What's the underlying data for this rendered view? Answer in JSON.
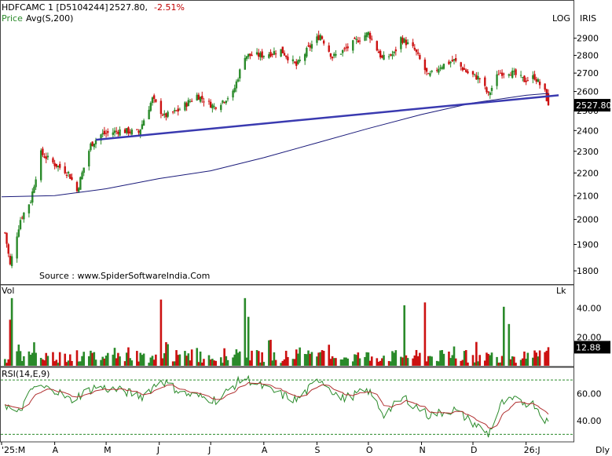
{
  "header": {
    "symbol": "HDFCAMC 1 [D5104244]",
    "last": "2527.80,",
    "change": "-2.51%",
    "price_label": "Price",
    "avg_label": "Avg(S,200)",
    "log_label": "LOG",
    "iris_label": "IRIS"
  },
  "source_text": "Source : www.SpiderSoftwareIndia.Com",
  "colors": {
    "up": "#2a8a2a",
    "down": "#cc1111",
    "ma": "#1a1a7a",
    "trendline": "#3a3ab0",
    "rsi": "#2a8a2a",
    "rsi_signal": "#b03030",
    "guide": "#2a8a2a"
  },
  "chart_data": [
    {
      "type": "candlestick",
      "panel": "price",
      "scale": "log",
      "ylim": [
        1780,
        2960
      ],
      "yticks": [
        "2900",
        "2800",
        "2700",
        "2600",
        "2500",
        "2400",
        "2300",
        "2200",
        "2100",
        "2000",
        "1900",
        "1800"
      ],
      "last_value_label": "2527.80",
      "anchors": [
        {
          "x": "2025-03-01",
          "close": 2030
        },
        {
          "x": "2025-03-06",
          "close": 1820
        },
        {
          "x": "2025-03-12",
          "close": 2000
        },
        {
          "x": "2025-03-18",
          "close": 2080
        },
        {
          "x": "2025-03-24",
          "close": 2290
        },
        {
          "x": "2025-04-01",
          "close": 2240
        },
        {
          "x": "2025-04-09",
          "close": 2200
        },
        {
          "x": "2025-04-14",
          "close": 2120
        },
        {
          "x": "2025-04-22",
          "close": 2330
        },
        {
          "x": "2025-04-28",
          "close": 2380
        },
        {
          "x": "2025-05-09",
          "close": 2400
        },
        {
          "x": "2025-05-20",
          "close": 2390
        },
        {
          "x": "2025-05-28",
          "close": 2560
        },
        {
          "x": "2025-06-04",
          "close": 2470
        },
        {
          "x": "2025-06-12",
          "close": 2500
        },
        {
          "x": "2025-06-23",
          "close": 2580
        },
        {
          "x": "2025-07-03",
          "close": 2520
        },
        {
          "x": "2025-07-14",
          "close": 2590
        },
        {
          "x": "2025-07-21",
          "close": 2800
        },
        {
          "x": "2025-07-31",
          "close": 2800
        },
        {
          "x": "2025-08-11",
          "close": 2830
        },
        {
          "x": "2025-08-20",
          "close": 2740
        },
        {
          "x": "2025-08-27",
          "close": 2840
        },
        {
          "x": "2025-09-03",
          "close": 2920
        },
        {
          "x": "2025-09-10",
          "close": 2790
        },
        {
          "x": "2025-09-17",
          "close": 2830
        },
        {
          "x": "2025-09-26",
          "close": 2900
        },
        {
          "x": "2025-10-01",
          "close": 2930
        },
        {
          "x": "2025-10-09",
          "close": 2780
        },
        {
          "x": "2025-10-16",
          "close": 2810
        },
        {
          "x": "2025-10-20",
          "close": 2900
        },
        {
          "x": "2025-10-28",
          "close": 2830
        },
        {
          "x": "2025-11-05",
          "close": 2680
        },
        {
          "x": "2025-11-12",
          "close": 2740
        },
        {
          "x": "2025-11-20",
          "close": 2770
        },
        {
          "x": "2025-11-28",
          "close": 2700
        },
        {
          "x": "2025-12-05",
          "close": 2670
        },
        {
          "x": "2025-12-10",
          "close": 2580
        },
        {
          "x": "2025-12-16",
          "close": 2700
        },
        {
          "x": "2025-12-22",
          "close": 2710
        },
        {
          "x": "2025-12-31",
          "close": 2660
        },
        {
          "x": "2026-01-06",
          "close": 2680
        },
        {
          "x": "2026-01-12",
          "close": 2595
        },
        {
          "x": "2026-01-14",
          "close": 2527.8
        }
      ],
      "ma200": [
        {
          "x": "2025-03-01",
          "y": 2095
        },
        {
          "x": "2025-04-01",
          "y": 2100
        },
        {
          "x": "2025-05-01",
          "y": 2130
        },
        {
          "x": "2025-06-01",
          "y": 2175
        },
        {
          "x": "2025-07-01",
          "y": 2210
        },
        {
          "x": "2025-08-01",
          "y": 2270
        },
        {
          "x": "2025-09-01",
          "y": 2340
        },
        {
          "x": "2025-10-01",
          "y": 2410
        },
        {
          "x": "2025-11-01",
          "y": 2480
        },
        {
          "x": "2025-12-01",
          "y": 2540
        },
        {
          "x": "2026-01-01",
          "y": 2580
        },
        {
          "x": "2026-01-14",
          "y": 2590
        }
      ],
      "trendline": [
        {
          "x": "2025-04-25",
          "y": 2355
        },
        {
          "x": "2026-01-20",
          "y": 2580
        }
      ]
    },
    {
      "type": "bar",
      "panel": "volume",
      "label": "Vol",
      "unit_label": "Lk",
      "ylim": [
        0,
        48
      ],
      "yticks": [
        "40.00",
        "20.00"
      ],
      "last_value_label": "12.88",
      "spikes": [
        {
          "x": "2025-03-07",
          "y": 47
        },
        {
          "x": "2025-03-06",
          "y": 32
        },
        {
          "x": "2025-06-02",
          "y": 46
        },
        {
          "x": "2025-07-21",
          "y": 47
        },
        {
          "x": "2025-07-23",
          "y": 34
        },
        {
          "x": "2025-10-22",
          "y": 42
        },
        {
          "x": "2025-11-03",
          "y": 44
        },
        {
          "x": "2025-12-19",
          "y": 41
        },
        {
          "x": "2025-12-22",
          "y": 29
        }
      ],
      "last": 12.88
    },
    {
      "type": "line",
      "panel": "rsi",
      "label": "RSI(14,E,9)",
      "ylim": [
        25,
        77
      ],
      "yticks": [
        "60.00",
        "40.00"
      ],
      "guides": [
        70,
        30
      ],
      "anchors": [
        {
          "x": "2025-03-01",
          "y": 55
        },
        {
          "x": "2025-03-10",
          "y": 44
        },
        {
          "x": "2025-03-20",
          "y": 65
        },
        {
          "x": "2025-04-01",
          "y": 63
        },
        {
          "x": "2025-04-10",
          "y": 55
        },
        {
          "x": "2025-04-25",
          "y": 65
        },
        {
          "x": "2025-05-10",
          "y": 62
        },
        {
          "x": "2025-05-22",
          "y": 58
        },
        {
          "x": "2025-06-02",
          "y": 70
        },
        {
          "x": "2025-06-15",
          "y": 60
        },
        {
          "x": "2025-07-05",
          "y": 55
        },
        {
          "x": "2025-07-20",
          "y": 72
        },
        {
          "x": "2025-08-05",
          "y": 62
        },
        {
          "x": "2025-08-20",
          "y": 55
        },
        {
          "x": "2025-09-03",
          "y": 71
        },
        {
          "x": "2025-09-15",
          "y": 56
        },
        {
          "x": "2025-10-01",
          "y": 62
        },
        {
          "x": "2025-10-10",
          "y": 45
        },
        {
          "x": "2025-10-22",
          "y": 57
        },
        {
          "x": "2025-11-05",
          "y": 44
        },
        {
          "x": "2025-11-20",
          "y": 48
        },
        {
          "x": "2025-12-05",
          "y": 35
        },
        {
          "x": "2025-12-10",
          "y": 30
        },
        {
          "x": "2025-12-18",
          "y": 53
        },
        {
          "x": "2025-12-25",
          "y": 55
        },
        {
          "x": "2026-01-06",
          "y": 52
        },
        {
          "x": "2026-01-14",
          "y": 38
        }
      ]
    }
  ],
  "x_axis": {
    "labels": [
      {
        "text": "'25:M",
        "x": "2025-03-01"
      },
      {
        "text": "A",
        "x": "2025-04-01"
      },
      {
        "text": "M",
        "x": "2025-05-01"
      },
      {
        "text": "J",
        "x": "2025-06-01"
      },
      {
        "text": "J",
        "x": "2025-07-01"
      },
      {
        "text": "A",
        "x": "2025-08-01"
      },
      {
        "text": "S",
        "x": "2025-09-01"
      },
      {
        "text": "O",
        "x": "2025-10-01"
      },
      {
        "text": "N",
        "x": "2025-11-01"
      },
      {
        "text": "D",
        "x": "2025-12-01"
      },
      {
        "text": "26:J",
        "x": "2026-01-01"
      }
    ],
    "period_label": "Dly"
  }
}
